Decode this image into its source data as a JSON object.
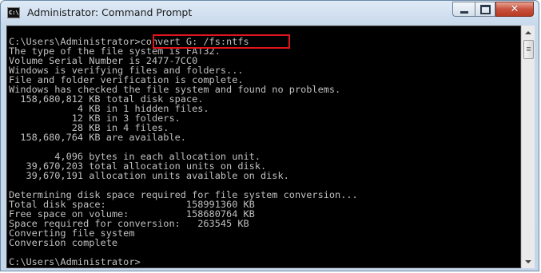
{
  "window": {
    "title": "Administrator: Command Prompt",
    "icon": "cmd-icon",
    "icon_text": "C:\\"
  },
  "controls": {
    "minimize": "minimize-icon",
    "maximize": "maximize-icon",
    "close": "✕"
  },
  "console": {
    "lines": [
      "C:\\Users\\Administrator>convert G: /fs:ntfs",
      "The type of the file system is FAT32.",
      "Volume Serial Number is 2477-7CC0",
      "Windows is verifying files and folders...",
      "File and folder verification is complete.",
      "Windows has checked the file system and found no problems.",
      "  158,680,812 KB total disk space.",
      "            4 KB in 1 hidden files.",
      "           12 KB in 3 folders.",
      "           28 KB in 4 files.",
      "  158,680,764 KB are available.",
      "",
      "        4,096 bytes in each allocation unit.",
      "   39,670,203 total allocation units on disk.",
      "   39,670,191 allocation units available on disk.",
      "",
      "Determining disk space required for file system conversion...",
      "Total disk space:              158991360 KB",
      "Free space on volume:          158680764 KB",
      "Space required for conversion:   263545 KB",
      "Converting file system",
      "Conversion complete",
      "",
      "C:\\Users\\Administrator>"
    ]
  },
  "colors": {
    "console_background": "#000000",
    "console_text": "#c0c0c0",
    "highlight_box": "#e0141c"
  }
}
